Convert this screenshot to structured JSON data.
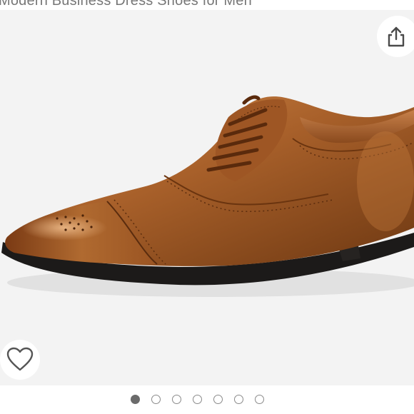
{
  "product": {
    "title": "Modern Business Dress Shoes for Men"
  },
  "gallery": {
    "image_count": 7,
    "active_index": 0,
    "image_subject": "brown leather cap-toe oxford shoe"
  },
  "actions": {
    "share_icon": "share-icon",
    "favorite_icon": "heart-outline-icon"
  },
  "colors": {
    "image_background": "#f3f3f3",
    "leather": "#a8602a",
    "sole": "#1c1a19",
    "active_dot": "#6b6b6b"
  }
}
